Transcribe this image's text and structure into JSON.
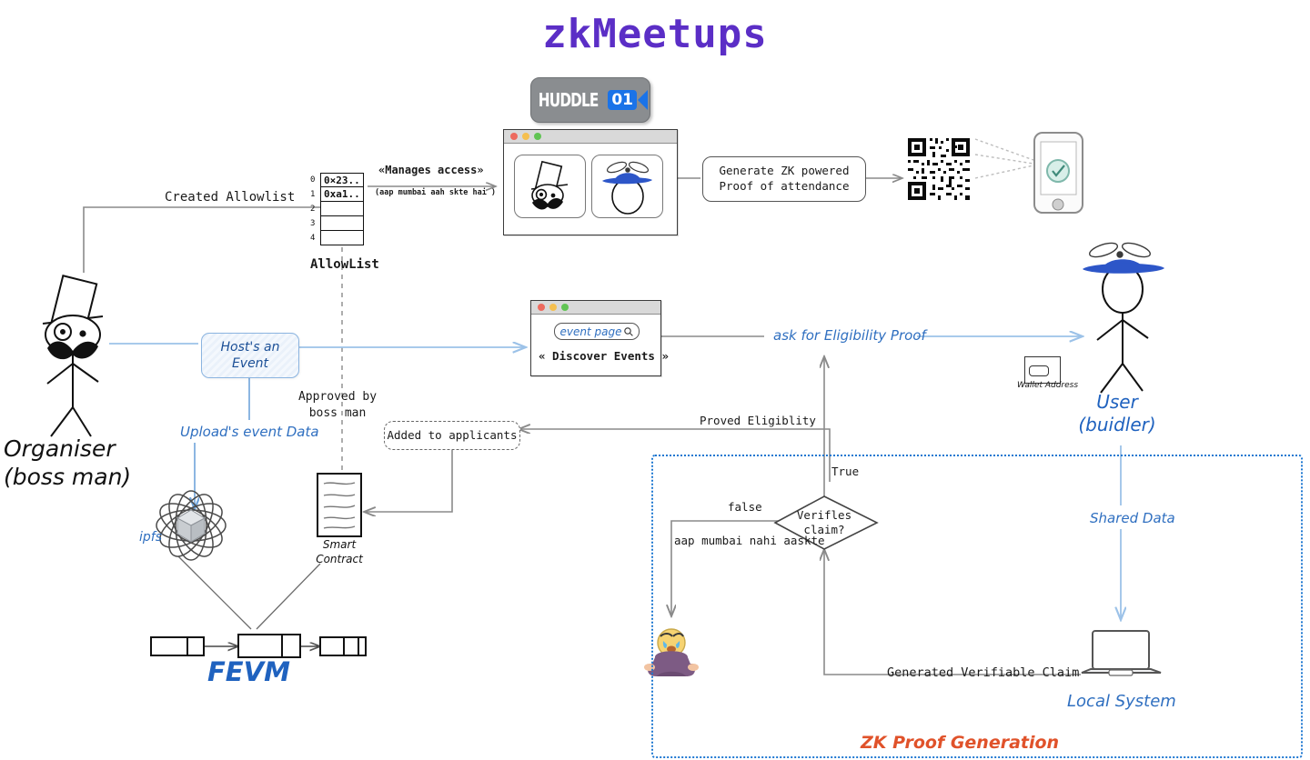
{
  "page": {
    "title": "zkMeetups",
    "title_color": "#5b2ec6",
    "background": "#ffffff"
  },
  "huddle_badge": {
    "name": "HUDDLE",
    "number": "01",
    "badge_color": "#8a8d90",
    "accent_color": "#1a73e8"
  },
  "allowlist": {
    "label": "AllowList",
    "indices": [
      "0",
      "1",
      "2",
      "3",
      "4"
    ],
    "values": [
      "0×23..",
      "0xa1..",
      "",
      "",
      ""
    ]
  },
  "edges": {
    "created_allowlist": "Created Allowlist",
    "manages_access": "«Manages access»",
    "manages_access_note": "(aap mumbai aah skte hai )",
    "upload_event_data": "Upload's event Data",
    "approved_by_boss_man": "Approved by\nboss man",
    "ask_for_eligibility": "ask for Eligibility Proof",
    "proved_eligibility": "Proved Eligiblity",
    "true_branch": "True",
    "false_branch": "false",
    "false_note": "aap mumbai nahi aaskte",
    "shared_data": "Shared Data",
    "generated_verifiable_claim": "Generated Verifiable Claim"
  },
  "nodes": {
    "hosts_an_event": "Host's an\nEvent",
    "generate_zk_proof": "Generate ZK powered\nProof of attendance",
    "added_to_applicants": "Added to applicants",
    "verifies_claim": "Verifles\nclaim?",
    "smart_contract": "Smart\nContract",
    "ipfs": "ipfs",
    "fevm": "FEVM",
    "local_system": "Local System",
    "wallet_address": "Wallet Address",
    "zk_proof_generation": "ZK Proof Generation"
  },
  "actors": {
    "organiser": "Organiser\n(boss man)",
    "user": "User\n(buidler)"
  },
  "event_browser": {
    "search_value": "event page",
    "discover_events": "« Discover Events »"
  },
  "colors": {
    "purple": "#5b2ec6",
    "blue_hand": "#2f6fc0",
    "blue_strong": "#1b4f96",
    "orange": "#e0522a",
    "zk_border": "#1f78d1",
    "gray_edge": "#8a8a8a"
  }
}
